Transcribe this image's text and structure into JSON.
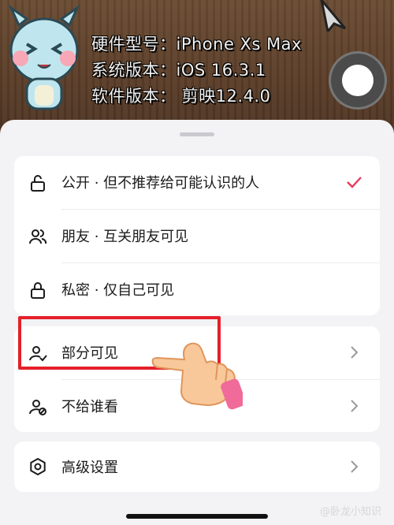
{
  "banner": {
    "device_model": "硬件型号：iPhone Xs Max",
    "os_version": "系统版本：iOS 16.3.1",
    "app_version": "软件版本： 剪映12.4.0"
  },
  "visibility_options": [
    {
      "label": "公开 · 但不推荐给可能认识的人",
      "icon": "unlock-icon",
      "selected": true
    },
    {
      "label": "朋友 · 互关朋友可见",
      "icon": "friends-icon",
      "selected": false
    },
    {
      "label": "私密 · 仅自己可见",
      "icon": "lock-icon",
      "selected": false
    }
  ],
  "audience_options": [
    {
      "label": "部分可见",
      "icon": "user-check-icon"
    },
    {
      "label": "不给谁看",
      "icon": "user-block-icon"
    }
  ],
  "advanced": {
    "label": "高级设置",
    "icon": "gear-icon"
  },
  "watermark": "@卧龙小知识",
  "colors": {
    "accent": "#e8395a",
    "highlight": "#e4202a"
  }
}
